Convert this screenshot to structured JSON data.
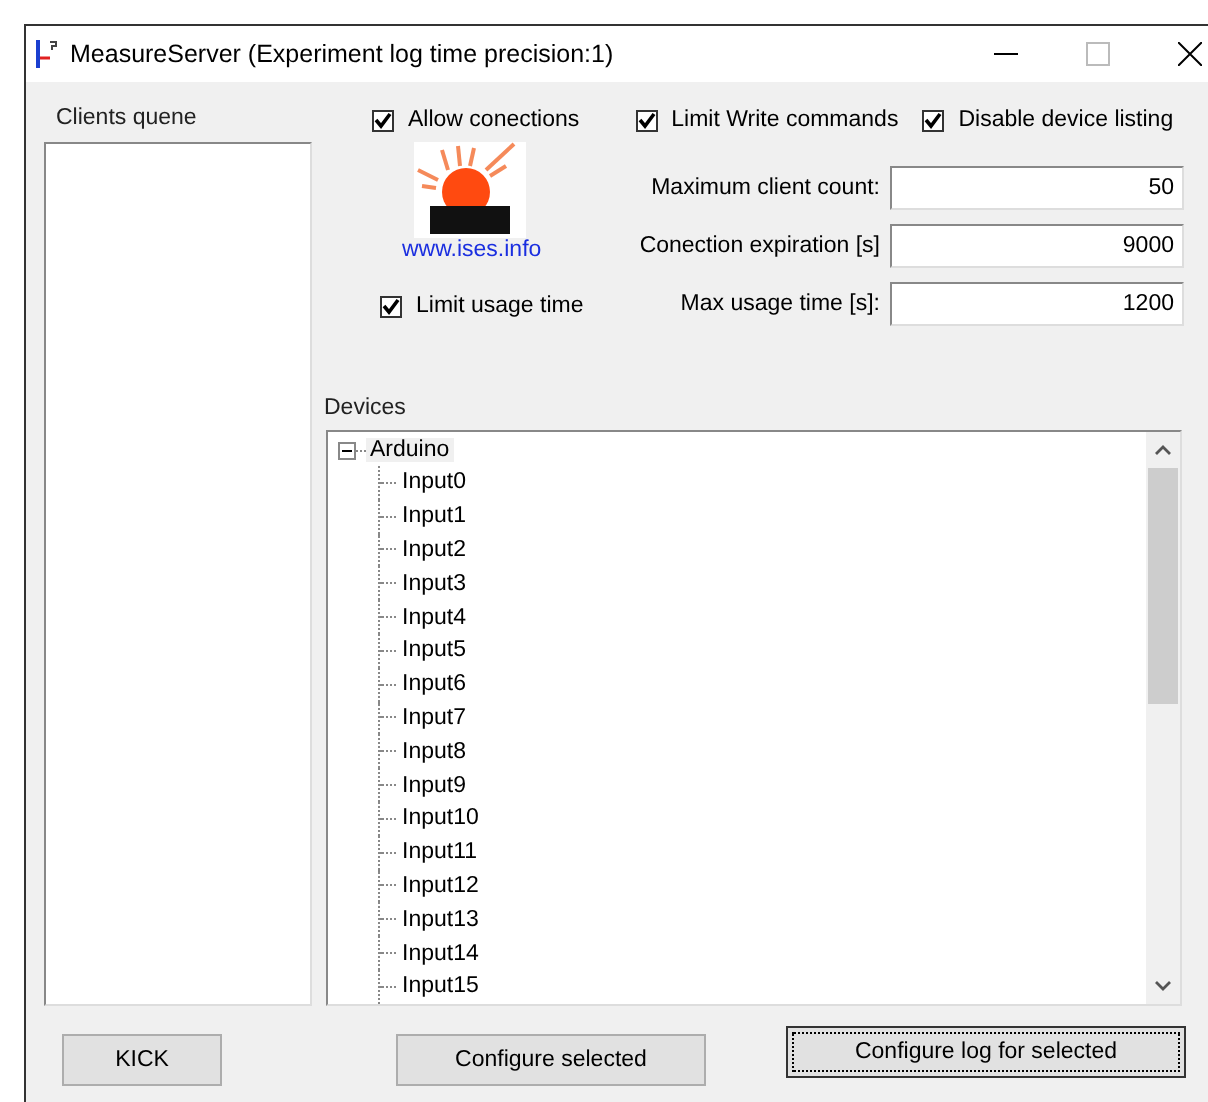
{
  "window": {
    "title": "MeasureServer (Experiment log time precision:1)"
  },
  "clients": {
    "label": "Clients quene"
  },
  "options": [
    {
      "label": "Allow conections",
      "checked": true
    },
    {
      "label": "Limit Write commands",
      "checked": true
    },
    {
      "label": "Disable device listing",
      "checked": true
    }
  ],
  "logo": {
    "link": "www.ises.info"
  },
  "limit_usage": {
    "label": "Limit usage time",
    "checked": true
  },
  "fields": [
    {
      "label": "Maximum client count:",
      "value": "50"
    },
    {
      "label": "Conection expiration [s]",
      "value": "9000"
    },
    {
      "label": "Max usage time [s]:",
      "value": "1200"
    }
  ],
  "devices": {
    "label": "Devices",
    "tree": [
      {
        "label": "Arduino",
        "expanded": true,
        "children": [
          {
            "label": "Input0"
          },
          {
            "label": "Input1"
          },
          {
            "label": "Input2"
          },
          {
            "label": "Input3"
          },
          {
            "label": "Input4"
          },
          {
            "label": "Input5"
          },
          {
            "label": "Input6"
          },
          {
            "label": "Input7"
          },
          {
            "label": "Input8"
          },
          {
            "label": "Input9"
          },
          {
            "label": "Input10"
          },
          {
            "label": "Input11"
          },
          {
            "label": "Input12"
          },
          {
            "label": "Input13"
          },
          {
            "label": "Input14"
          },
          {
            "label": "Input15"
          }
        ]
      }
    ]
  },
  "buttons": [
    {
      "label": "KICK",
      "focused": false
    },
    {
      "label": "Configure selected",
      "focused": false
    },
    {
      "label": "Configure log for selected",
      "focused": true
    }
  ]
}
